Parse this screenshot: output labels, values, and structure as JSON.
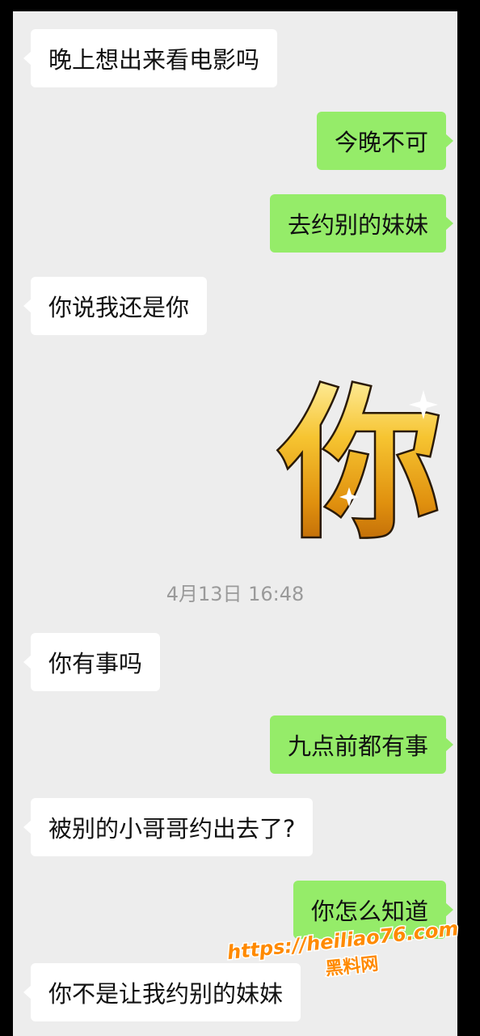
{
  "chat": {
    "messages": [
      {
        "side": "left",
        "text": "晚上想出来看电影吗"
      },
      {
        "side": "right",
        "text": "今晚不可"
      },
      {
        "side": "right",
        "text": "去约别的妹妹"
      },
      {
        "side": "left",
        "text": "你说我还是你"
      },
      {
        "side": "right",
        "type": "sticker",
        "text": "你"
      },
      {
        "type": "timestamp",
        "text": "4月13日 16:48"
      },
      {
        "side": "left",
        "text": "你有事吗"
      },
      {
        "side": "right",
        "text": "九点前都有事"
      },
      {
        "side": "left",
        "text": "被别的小哥哥约出去了?"
      },
      {
        "side": "right",
        "text": "你怎么知道"
      },
      {
        "side": "left",
        "text": "你不是让我约别的妹妹"
      }
    ]
  },
  "watermark": {
    "url": "https://heiliao76.com",
    "label": "黑料网"
  },
  "colors": {
    "background": "#ededed",
    "incoming_bubble": "#ffffff",
    "outgoing_bubble": "#95ec69",
    "sticker_gold": "#f2b21c",
    "watermark_orange": "#ff8a00"
  }
}
